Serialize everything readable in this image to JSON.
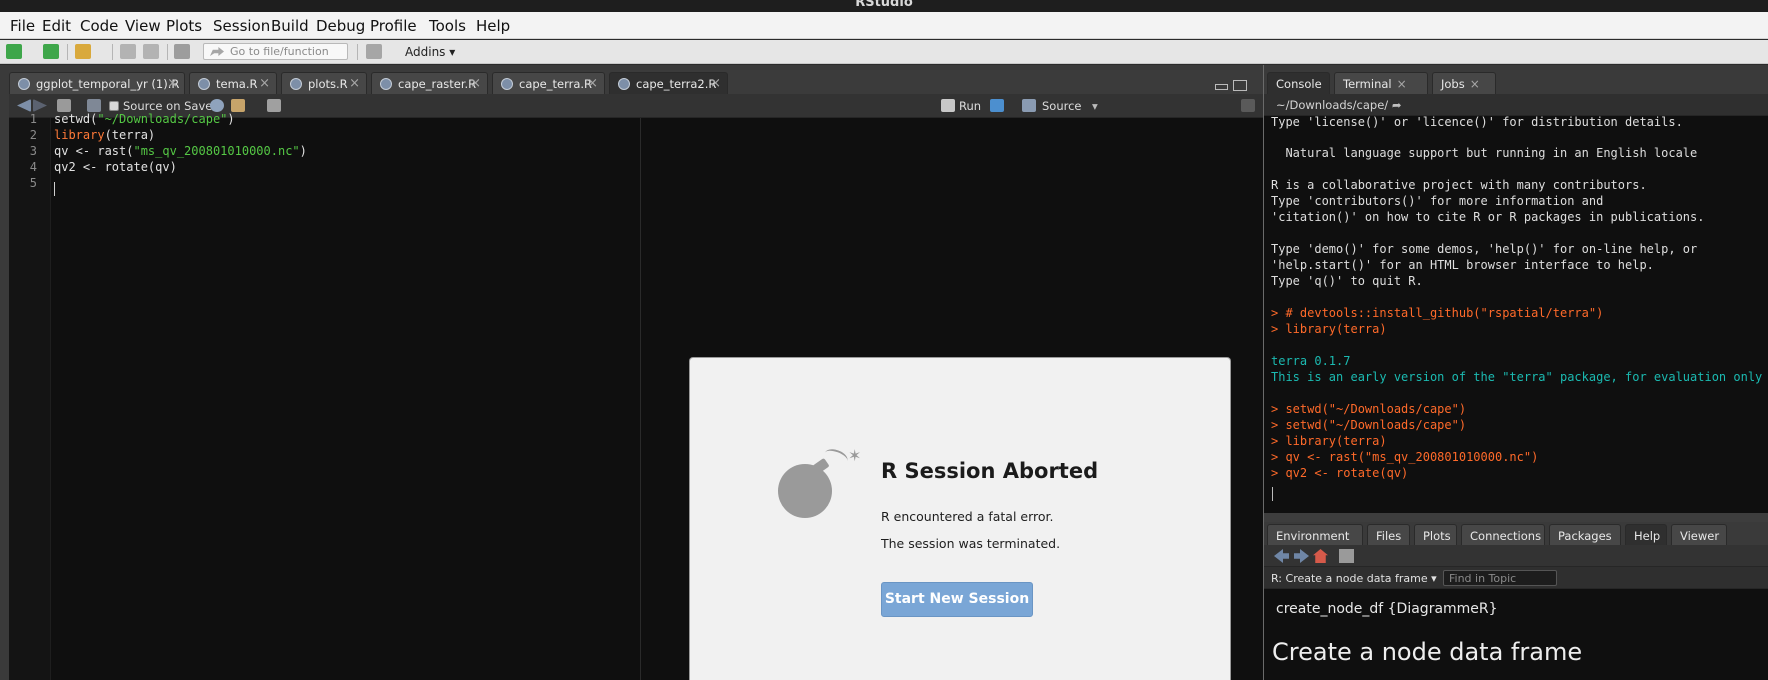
{
  "window": {
    "title": "RStudio"
  },
  "menu": [
    "File",
    "Edit",
    "Code",
    "View",
    "Plots",
    "Session",
    "Build",
    "Debug",
    "Profile",
    "Tools",
    "Help"
  ],
  "toolbar": {
    "goto_placeholder": "Go to file/function",
    "addins": "Addins"
  },
  "source": {
    "tabs": [
      "ggplot_temporal_yr (1).R",
      "tema.R",
      "plots.R",
      "cape_raster.R",
      "cape_terra.R",
      "cape_terra2.R"
    ],
    "active_tab": "cape_terra2.R",
    "source_on_save": "Source on Save",
    "run": "Run",
    "source": "Source",
    "line_numbers": [
      "1",
      "2",
      "3",
      "4",
      "5"
    ],
    "lines": [
      {
        "a": "setwd(",
        "b": "\"~/Downloads/cape\"",
        "c": ")"
      },
      {
        "a": "library",
        "b": "(terra)",
        "c": ""
      },
      {
        "a": "qv <- rast(",
        "b": "\"ms_qv_200801010000.nc\"",
        "c": ")"
      },
      {
        "a": "qv2 <- rotate(qv)",
        "b": "",
        "c": ""
      }
    ]
  },
  "console": {
    "tabs": [
      "Console",
      "Terminal",
      "Jobs"
    ],
    "path": "~/Downloads/cape/",
    "lines": [
      {
        "kind": "out",
        "text": "Type 'license()' or 'licence()' for distribution details."
      },
      {
        "kind": "out",
        "text": "  Natural language support but running in an English locale"
      },
      {
        "kind": "out",
        "text": "R is a collaborative project with many contributors."
      },
      {
        "kind": "out",
        "text": "Type 'contributors()' for more information and"
      },
      {
        "kind": "out",
        "text": "'citation()' on how to cite R or R packages in publications."
      },
      {
        "kind": "out",
        "text": "Type 'demo()' for some demos, 'help()' for on-line help, or"
      },
      {
        "kind": "out",
        "text": "'help.start()' for an HTML browser interface to help."
      },
      {
        "kind": "out",
        "text": "Type 'q()' to quit R."
      },
      {
        "kind": "cmd",
        "text": "> # devtools::install_github(\"rspatial/terra\")"
      },
      {
        "kind": "cmd",
        "text": "> library(terra)"
      },
      {
        "kind": "msg",
        "text": "terra 0.1.7"
      },
      {
        "kind": "msg",
        "text": "This is an early version of the \"terra\" package, for evaluation only"
      },
      {
        "kind": "cmd",
        "text": "> setwd(\"~/Downloads/cape\")"
      },
      {
        "kind": "cmd",
        "text": "> setwd(\"~/Downloads/cape\")"
      },
      {
        "kind": "cmd",
        "text": "> library(terra)"
      },
      {
        "kind": "cmd",
        "text": "> qv <- rast(\"ms_qv_200801010000.nc\")"
      },
      {
        "kind": "cmd",
        "text": "> qv2 <- rotate(qv)"
      }
    ]
  },
  "help": {
    "tabs": [
      "Environment",
      "Files",
      "Plots",
      "Connections",
      "Packages",
      "Help",
      "Viewer"
    ],
    "active_tab": "Help",
    "topic": "R: Create a node data frame",
    "find_placeholder": "Find in Topic",
    "package_line": "create_node_df {DiagrammeR}",
    "heading": "Create a node data frame"
  },
  "modal": {
    "title": "R Session Aborted",
    "line1": "R encountered a fatal error.",
    "line2": "The session was terminated.",
    "button": "Start New Session"
  },
  "colors": {
    "keyword": "#ff7a38",
    "string": "#55c845",
    "console_cmd": "#ff6a2a",
    "console_msg": "#1bbab1",
    "button": "#7aa6d6"
  }
}
